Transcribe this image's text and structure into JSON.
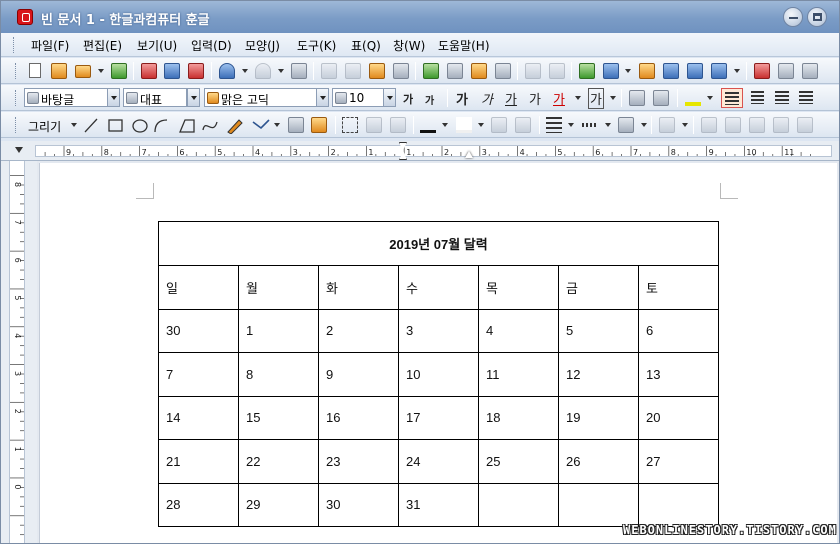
{
  "window": {
    "title": "빈 문서 1 - 한글과컴퓨터 훈글"
  },
  "menu": [
    "파일(F)",
    "편집(E)",
    "보기(U)",
    "입력(D)",
    "모양(J)",
    "도구(K)",
    "표(Q)",
    "창(W)",
    "도움말(H)"
  ],
  "format_bar": {
    "style": "바탕글",
    "lang": "대표",
    "font": "맑은 고딕",
    "size": "10"
  },
  "draw_bar": {
    "draw_label": "그리기"
  },
  "icons": {
    "bold_glyph": "가",
    "italic_glyph": "가",
    "underline_glyph": "가",
    "strike_glyph": "가",
    "color_glyph": "가",
    "shade_glyph": "가",
    "grow_glyph": "가",
    "shrink_glyph": "가"
  },
  "ruler": {
    "top_labels": [
      "9",
      "8",
      "7",
      "6",
      "5",
      "4",
      "3",
      "2",
      "1",
      "1",
      "2",
      "3",
      "4",
      "5",
      "6",
      "7",
      "8",
      "9",
      "10",
      "11"
    ],
    "left_labels": [
      "8",
      "7",
      "6",
      "5",
      "4",
      "3",
      "2",
      "1",
      "0"
    ]
  },
  "calendar": {
    "title": "2019년  07월  달력",
    "weekdays": [
      "일",
      "월",
      "화",
      "수",
      "목",
      "금",
      "토"
    ],
    "weeks": [
      [
        "30",
        "1",
        "2",
        "3",
        "4",
        "5",
        "6"
      ],
      [
        "7",
        "8",
        "9",
        "10",
        "11",
        "12",
        "13"
      ],
      [
        "14",
        "15",
        "16",
        "17",
        "18",
        "19",
        "20"
      ],
      [
        "21",
        "22",
        "23",
        "24",
        "25",
        "26",
        "27"
      ],
      [
        "28",
        "29",
        "30",
        "31",
        "",
        "",
        ""
      ]
    ]
  },
  "watermark": "WEBONLINESTORY.TISTORY.COM"
}
